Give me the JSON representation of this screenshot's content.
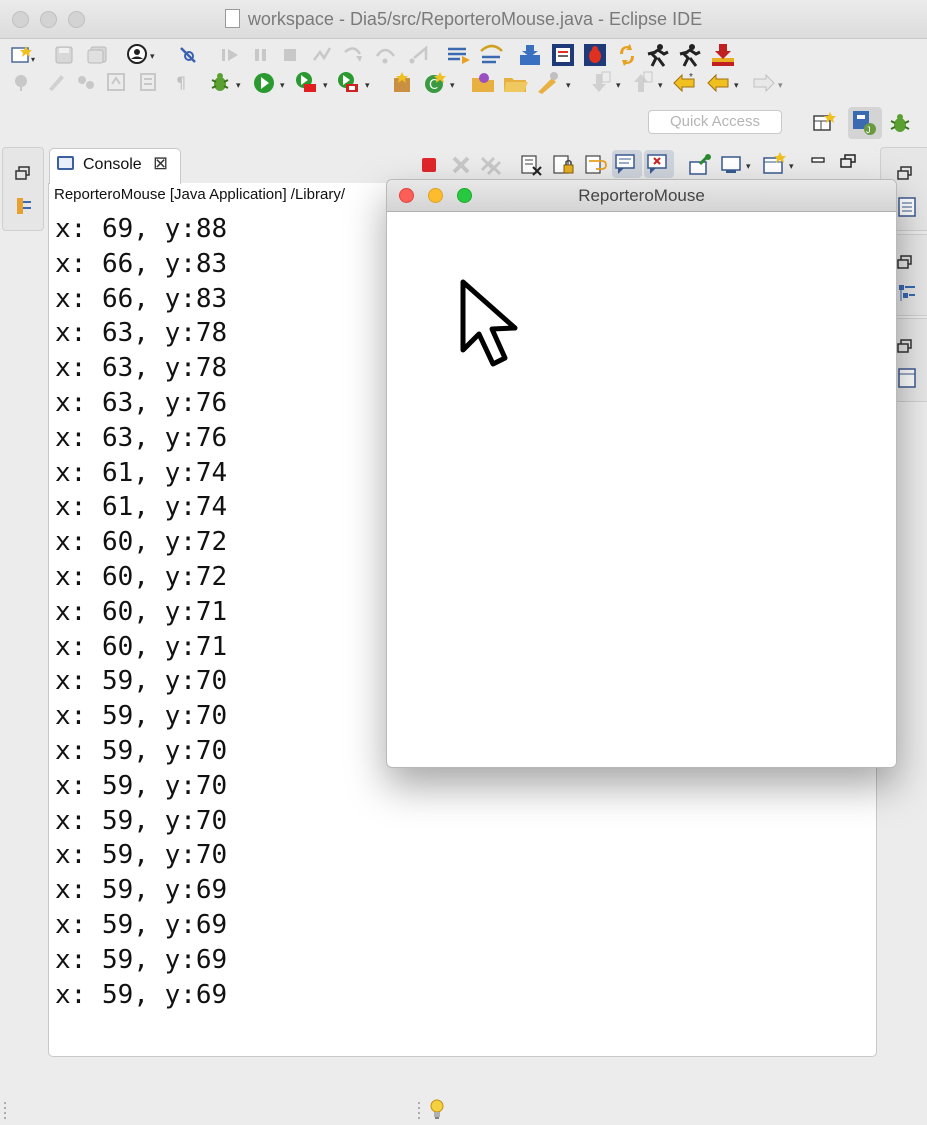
{
  "window": {
    "title": "workspace - Dia5/src/ReporteroMouse.java - Eclipse IDE"
  },
  "toolbar": {
    "quick_access_placeholder": "Quick Access"
  },
  "console": {
    "tab_label": "Console",
    "tab_close_glyph": "⊠",
    "description": "ReporteroMouse [Java Application] /Library/",
    "lines": [
      "x: 69, y:88",
      "x: 66, y:83",
      "x: 66, y:83",
      "x: 63, y:78",
      "x: 63, y:78",
      "x: 63, y:76",
      "x: 63, y:76",
      "x: 61, y:74",
      "x: 61, y:74",
      "x: 60, y:72",
      "x: 60, y:72",
      "x: 60, y:71",
      "x: 60, y:71",
      "x: 59, y:70",
      "x: 59, y:70",
      "x: 59, y:70",
      "x: 59, y:70",
      "x: 59, y:70",
      "x: 59, y:70",
      "x: 59, y:69",
      "x: 59, y:69",
      "x: 59, y:69",
      "x: 59, y:69"
    ]
  },
  "app_window": {
    "title": "ReporteroMouse"
  },
  "colors": {
    "close": "#fc5f57",
    "minimize": "#fdbc2e",
    "zoom": "#28c840",
    "terminate": "#e0262b"
  },
  "icons": {
    "console_tab": "console-icon",
    "cursor": "mouse-pointer-icon",
    "status": "lightbulb-icon"
  }
}
